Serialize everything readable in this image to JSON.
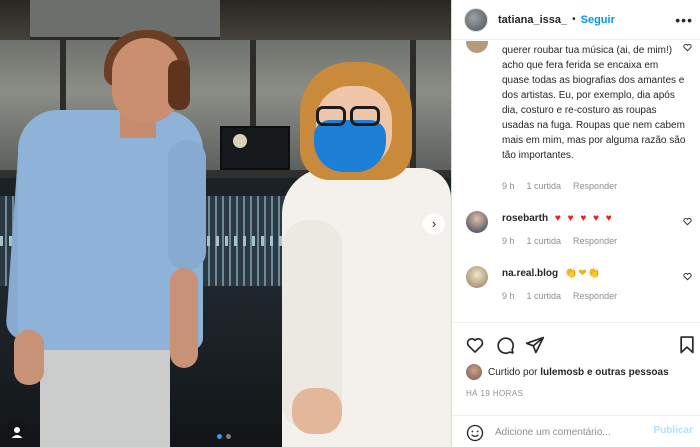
{
  "post": {
    "username": "tatiana_issa_",
    "separator": "•",
    "follow_label": "Seguir",
    "more_label": "•••"
  },
  "comments": [
    {
      "user": "",
      "text": "querer roubar tua música (ai, de mim!) acho que fera ferida se encaixa em quase todas as biografias dos amantes e dos artistas. Eu, por exemplo, dia após dia, costuro e re-costuro as roupas usadas na fuga. Roupas que nem cabem mais em mim, mas por alguma razão são tão importantes.",
      "time": "9 h",
      "likes": "1 curtida",
      "reply": "Responder"
    },
    {
      "user": "rosebarth",
      "text": "♥ ♥ ♥ ♥ ♥",
      "time": "9 h",
      "likes": "1 curtida",
      "reply": "Responder"
    },
    {
      "user": "na.real.blog",
      "text": "👏❤👏",
      "time": "9 h",
      "likes": "1 curtida",
      "reply": "Responder"
    }
  ],
  "likes_line": {
    "prefix": "Curtido por",
    "user": "lulemosb",
    "suffix": "e outras pessoas"
  },
  "timestamp": "HÁ 19 HORAS",
  "add_comment": {
    "placeholder": "Adicione um comentário...",
    "publish_label": "Publicar"
  },
  "carousel": {
    "next_label": "›",
    "total": 2,
    "current": 1
  },
  "colors": {
    "accent": "#0095f6",
    "publish_disabled": "#b2dffc",
    "muted": "#8e8e8e",
    "heart": "#ed1c24"
  }
}
